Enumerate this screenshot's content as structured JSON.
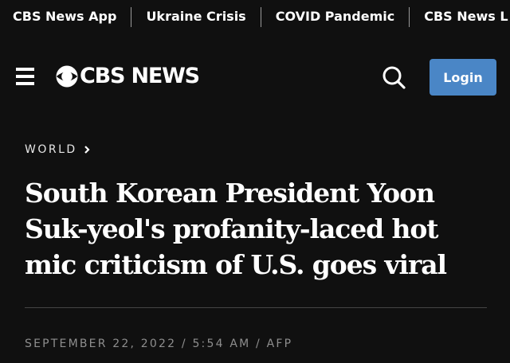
{
  "top_nav": {
    "links": [
      {
        "label": "CBS News App"
      },
      {
        "label": "Ukraine Crisis"
      },
      {
        "label": "COVID Pandemic"
      },
      {
        "label": "CBS News L"
      }
    ]
  },
  "header": {
    "menu_icon": "hamburger-menu-icon",
    "logo_text": "CBS NEWS",
    "search_icon": "search-icon",
    "login_label": "Login"
  },
  "article": {
    "section": "WORLD",
    "headline": "South Korean President Yoon Suk-yeol's profanity-laced hot mic criticism of U.S. goes viral",
    "byline": "SEPTEMBER 22, 2022 / 5:54 AM / AFP"
  },
  "colors": {
    "background": "#101010",
    "login_button": "#4a86c6",
    "byline": "#8e8e8e",
    "divider": "#444444"
  }
}
